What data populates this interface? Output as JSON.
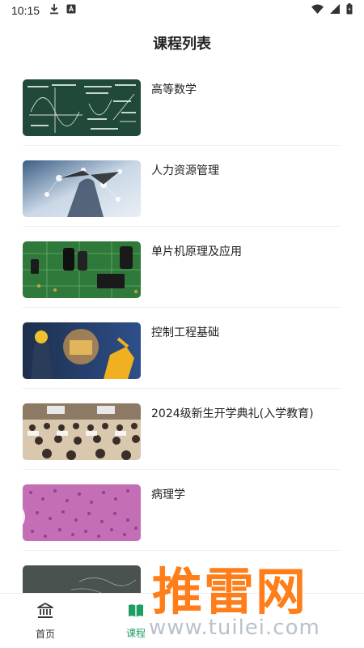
{
  "status": {
    "time": "10:15"
  },
  "header": {
    "title": "课程列表"
  },
  "courses": [
    {
      "title": "高等数学"
    },
    {
      "title": "人力资源管理"
    },
    {
      "title": "单片机原理及应用"
    },
    {
      "title": "控制工程基础"
    },
    {
      "title": "2024级新生开学典礼(入学教育)"
    },
    {
      "title": "病理学"
    },
    {
      "title": ""
    }
  ],
  "tabs": [
    {
      "label": "首页",
      "icon": "bank-icon"
    },
    {
      "label": "课程",
      "icon": "book-icon"
    }
  ],
  "watermark": {
    "main": "推雷网",
    "sub": "www.tuilei.com"
  },
  "colors": {
    "accent": "#1f9e63",
    "watermark": "#ff7e1a"
  }
}
